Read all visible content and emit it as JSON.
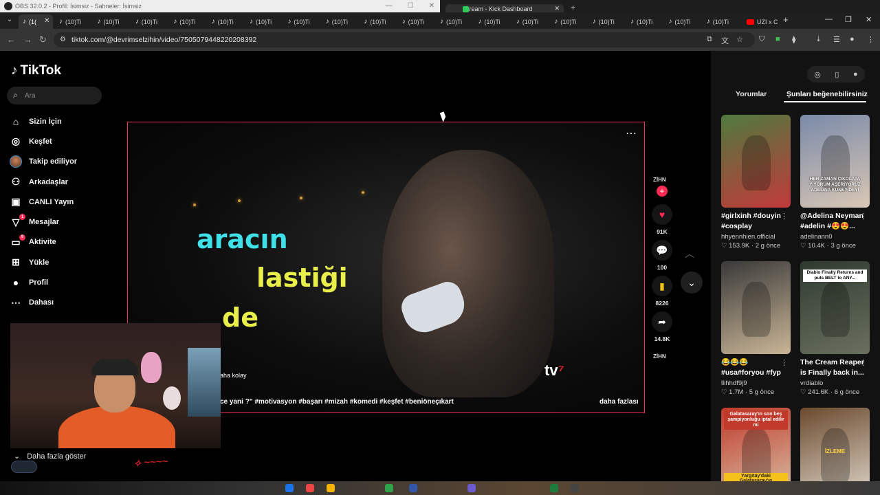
{
  "obs": {
    "title": "OBS 32.0.2 - Profil: İsimsiz - Sahneler: İsimsiz"
  },
  "stream_window": {
    "tab_title": "Stream - Kick Dashboard"
  },
  "browser": {
    "tabs": [
      {
        "label": "(1(",
        "active": true
      },
      {
        "label": "(10)Ti"
      },
      {
        "label": "(10)Ti"
      },
      {
        "label": "(10)Ti"
      },
      {
        "label": "(10)Ti"
      },
      {
        "label": "(10)Ti"
      },
      {
        "label": "(10)Ti"
      },
      {
        "label": "(10)Ti"
      },
      {
        "label": "(10)Ti"
      },
      {
        "label": "(10)Ti"
      },
      {
        "label": "(10)Ti"
      },
      {
        "label": "(10)Ti"
      },
      {
        "label": "(10)Ti"
      },
      {
        "label": "(10)Ti"
      },
      {
        "label": "(10)Ti"
      },
      {
        "label": "(10)Ti"
      },
      {
        "label": "(10)Ti"
      },
      {
        "label": "(10)Ti"
      },
      {
        "label": "(10)Ti"
      },
      {
        "label": "UZI x C",
        "youtube": true
      }
    ],
    "url": "tiktok.com/@devrimselzihin/video/7505079448220208392"
  },
  "tiktok": {
    "logo": "TikTok",
    "search_placeholder": "Ara",
    "nav": [
      {
        "label": "Sizin İçin",
        "icon": "home-icon",
        "glyph": "⌂"
      },
      {
        "label": "Keşfet",
        "icon": "compass-icon",
        "glyph": "◎"
      },
      {
        "label": "Takip ediliyor",
        "icon": "following-avatar",
        "glyph": ""
      },
      {
        "label": "Arkadaşlar",
        "icon": "friends-icon",
        "glyph": "⚇"
      },
      {
        "label": "CANLI Yayın",
        "icon": "live-icon",
        "glyph": "▣"
      },
      {
        "label": "Mesajlar",
        "icon": "messages-icon",
        "glyph": "▽",
        "badge": "1"
      },
      {
        "label": "Aktivite",
        "icon": "activity-icon",
        "glyph": "▭",
        "badge": "9"
      },
      {
        "label": "Yükle",
        "icon": "upload-icon",
        "glyph": "⊞"
      },
      {
        "label": "Profil",
        "icon": "profile-avatar",
        "glyph": "●"
      },
      {
        "label": "Dahası",
        "icon": "more-icon",
        "glyph": "⋯"
      }
    ],
    "show_more": "Daha fazla göster",
    "video": {
      "caption_1": "aracın",
      "caption_2": "lastiği",
      "caption_3": "de",
      "channel_logo": "tv",
      "desc_short": "aha kolay",
      "desc_tags": "ce yani ?\"  #motivasyon #başarı #mizah #komedi #keşfet #beniöneçıkart",
      "more": "daha fazlası"
    },
    "actions": {
      "creator_tag": "ZİHN",
      "likes": "91K",
      "comments": "100",
      "saves": "8226",
      "shares": "14.8K",
      "footer_tag": "ZİHN"
    },
    "right_panel": {
      "tab_comments": "Yorumlar",
      "tab_suggested": "Şunları beğenebilirsiniz",
      "cards": [
        {
          "title": "#girlxinh #douyin #cosplay",
          "author": "hhyennhien.official",
          "likes": "153.9K",
          "age": "2 g önce",
          "colors": [
            "#4f7a3d",
            "#c23a3a"
          ]
        },
        {
          "title": "@Adelina Neyman #adelin #😍😍...",
          "author": "adelinann0",
          "likes": "10.4K",
          "age": "3 g önce",
          "colors": [
            "#7a8aa8",
            "#d9c7b5"
          ]
        },
        {
          "title": "😂😂😂 #usa#foryou #fyp",
          "author": "llihhdf9j9",
          "likes": "1.7M",
          "age": "5 g önce",
          "colors": [
            "#3a3a3a",
            "#c9b596"
          ]
        },
        {
          "title": "The Cream Reaper is Finally back in...",
          "author": "vrdiablo",
          "likes": "241.6K",
          "age": "6 g önce",
          "colors": [
            "#2f3a2f",
            "#6a7060"
          ]
        },
        {
          "title": "",
          "author": "",
          "likes": "",
          "age": "",
          "colors": [
            "#c0392b",
            "#d8c4a8"
          ]
        },
        {
          "title": "",
          "author": "",
          "likes": "",
          "age": "",
          "colors": [
            "#6b4a2e",
            "#e0d8cc"
          ]
        }
      ],
      "thumb_text": {
        "c2": "HER ZAMAN ÇIKOLATA YİYORUM AŞERİYORUZ ADELİNA KUNEY DEYİ",
        "c4": "Diablo Finally Returns and puts BELT to ANY...",
        "c5_top": "Galatasaray'ın son beş şampiyonluğu iptal edilir mi",
        "c5_bottom": "Yargıtay'daki Galatasaray'ın",
        "c6": "İZLEME"
      }
    }
  },
  "colors": {
    "accent": "#fe2c55",
    "cyan_caption": "#3fe0e8",
    "yellow_caption": "#e8ee4a"
  }
}
